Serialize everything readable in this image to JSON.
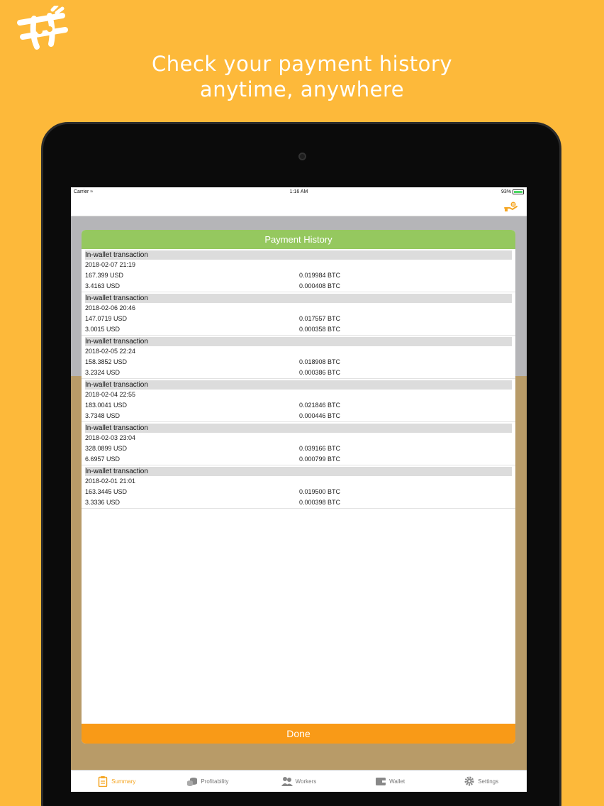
{
  "headline": {
    "line1": "Check your payment history",
    "line2": "anytime, anywhere"
  },
  "status_bar": {
    "carrier": "Carrier",
    "time": "1:16 AM",
    "battery": "93%"
  },
  "modal": {
    "title": "Payment History",
    "done_label": "Done",
    "transactions": [
      {
        "title": "In-wallet transaction",
        "date": "2018-02-07 21:19",
        "usd1": "167.399 USD",
        "btc1": "0.019984 BTC",
        "usd2": "3.4163 USD",
        "btc2": "0.000408 BTC"
      },
      {
        "title": "In-wallet transaction",
        "date": "2018-02-06 20:46",
        "usd1": "147.0719 USD",
        "btc1": "0.017557 BTC",
        "usd2": "3.0015 USD",
        "btc2": "0.000358 BTC"
      },
      {
        "title": "In-wallet transaction",
        "date": "2018-02-05 22:24",
        "usd1": "158.3852 USD",
        "btc1": "0.018908 BTC",
        "usd2": "3.2324 USD",
        "btc2": "0.000386 BTC"
      },
      {
        "title": "In-wallet transaction",
        "date": "2018-02-04 22:55",
        "usd1": "183.0041 USD",
        "btc1": "0.021846 BTC",
        "usd2": "3.7348 USD",
        "btc2": "0.000446 BTC"
      },
      {
        "title": "In-wallet transaction",
        "date": "2018-02-03 23:04",
        "usd1": "328.0899 USD",
        "btc1": "0.039166 BTC",
        "usd2": "6.6957 USD",
        "btc2": "0.000799 BTC"
      },
      {
        "title": "In-wallet transaction",
        "date": "2018-02-01 21:01",
        "usd1": "163.3445 USD",
        "btc1": "0.019500 BTC",
        "usd2": "3.3336 USD",
        "btc2": "0.000398 BTC"
      }
    ]
  },
  "tab_bar": {
    "tabs": [
      {
        "label": "Summary",
        "icon": "clipboard-icon",
        "active": true
      },
      {
        "label": "Profitability",
        "icon": "coins-icon",
        "active": false
      },
      {
        "label": "Workers",
        "icon": "workers-icon",
        "active": false
      },
      {
        "label": "Wallet",
        "icon": "wallet-icon",
        "active": false
      },
      {
        "label": "Settings",
        "icon": "gear-icon",
        "active": false
      }
    ]
  },
  "colors": {
    "background": "#FDB93A",
    "modal_header": "#95c85f",
    "done_button": "#f99a17",
    "active_tab": "#f5a623"
  }
}
